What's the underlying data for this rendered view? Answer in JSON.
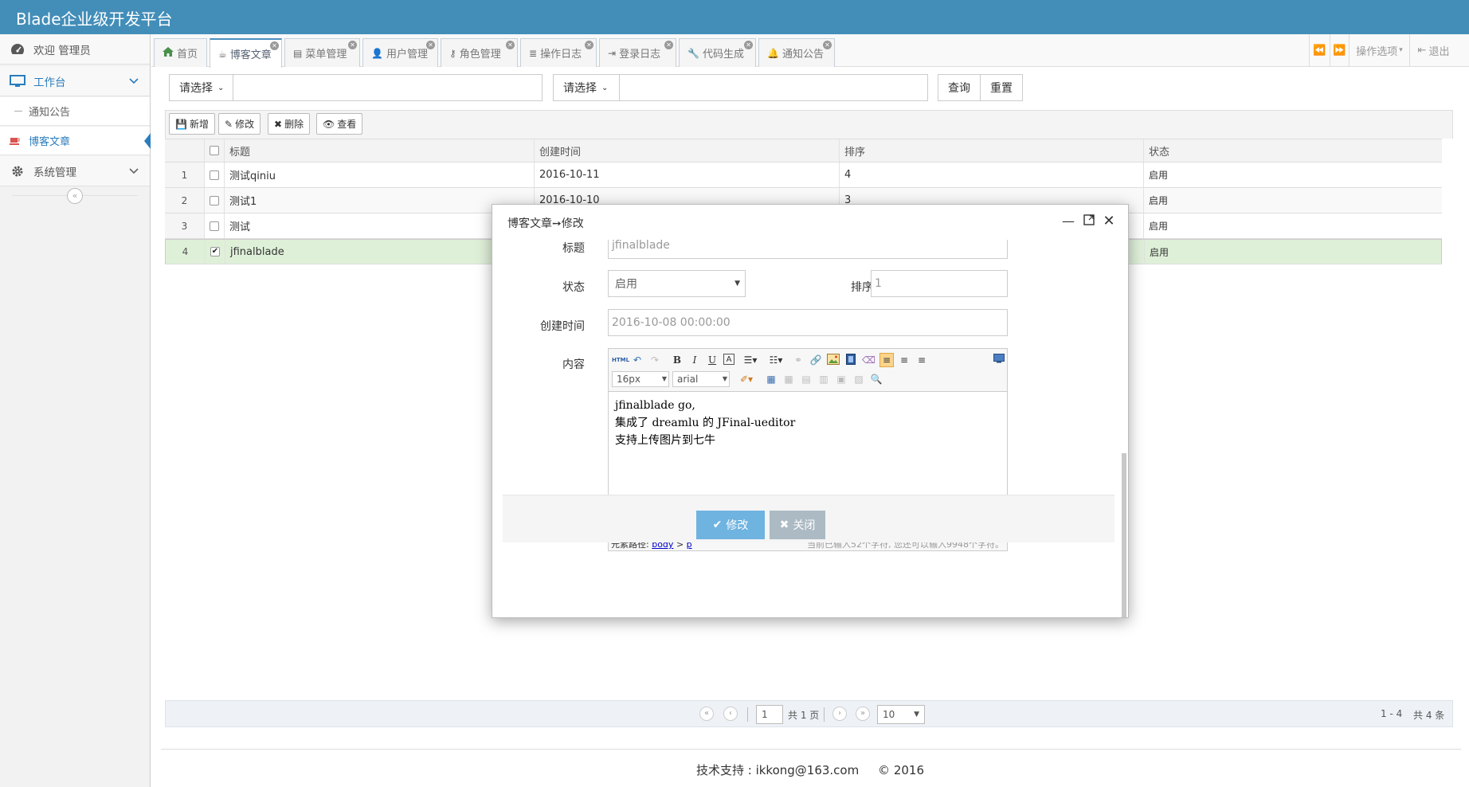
{
  "header": {
    "title": "Blade企业级开发平台"
  },
  "sidebar": {
    "welcome": "欢迎 管理员",
    "workbench": "工作台",
    "notice": "通知公告",
    "blog": "博客文章",
    "system": "系统管理"
  },
  "tabs": [
    {
      "label": "首页"
    },
    {
      "label": "博客文章"
    },
    {
      "label": "菜单管理"
    },
    {
      "label": "用户管理"
    },
    {
      "label": "角色管理"
    },
    {
      "label": "操作日志"
    },
    {
      "label": "登录日志"
    },
    {
      "label": "代码生成"
    },
    {
      "label": "通知公告"
    }
  ],
  "tabbar_right": {
    "options": "操作选项",
    "logout": "退出"
  },
  "search": {
    "select1": "请选择",
    "select2": "请选择",
    "query": "查询",
    "reset": "重置"
  },
  "toolbar": {
    "add": "新增",
    "edit": "修改",
    "delete": "删除",
    "view": "查看"
  },
  "grid": {
    "columns": [
      "标题",
      "创建时间",
      "排序",
      "状态"
    ],
    "rows": [
      {
        "n": "1",
        "title": "测试qiniu",
        "created": "2016-10-11",
        "order": "4",
        "status": "启用",
        "checked": false
      },
      {
        "n": "2",
        "title": "测试1",
        "created": "2016-10-10",
        "order": "3",
        "status": "启用",
        "checked": false
      },
      {
        "n": "3",
        "title": "测试",
        "created": "",
        "order": "",
        "status": "启用",
        "checked": false
      },
      {
        "n": "4",
        "title": "jfinalblade",
        "created": "",
        "order": "",
        "status": "启用",
        "checked": true
      }
    ]
  },
  "pager": {
    "page": "1",
    "total_pages": "共 1 页",
    "page_size": "10",
    "range": "1 - 4",
    "total": "共 4 条"
  },
  "footer": {
    "text": "技术支持 : ikkong@163.com     © 2016"
  },
  "dialog": {
    "title": "博客文章➙修改",
    "title_label": "标题",
    "title_value": "jfinalblade",
    "status_label": "状态",
    "status_value": "启用",
    "order_label": "排序",
    "order_value": "1",
    "created_label": "创建时间",
    "created_value": "2016-10-08 00:00:00",
    "content_label": "内容",
    "editor": {
      "font_size": "16px",
      "font_family": "arial",
      "lines": [
        "jfinalblade go,",
        "集成了 dreamlu 的 JFinal-ueditor",
        "支持上传图片到七牛"
      ],
      "path_label": "元素路径:",
      "path_body": "body",
      "path_sep": ">",
      "path_p": "p",
      "word_count": "当前已输入52个字符, 您还可以输入9948个字符。"
    },
    "save": "修改",
    "close": "关闭"
  }
}
